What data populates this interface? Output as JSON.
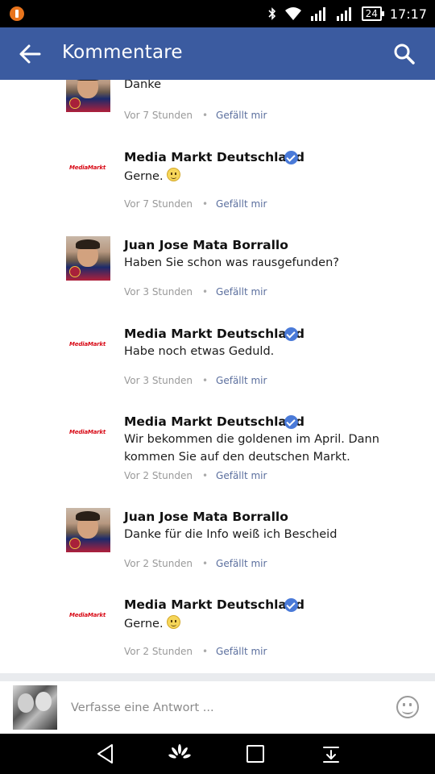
{
  "status": {
    "battery": "24",
    "time": "17:17"
  },
  "header": {
    "title": "Kommentare"
  },
  "comments": [
    {
      "author": "",
      "verified": false,
      "avatar": "person",
      "text": "Danke",
      "time": "Vor 7 Stunden",
      "like": "Gefällt mir",
      "emoji": false
    },
    {
      "author": "Media Markt Deutschland",
      "verified": true,
      "avatar": "mediamarkt",
      "text": "Gerne.",
      "time": "Vor 7 Stunden",
      "like": "Gefällt mir",
      "emoji": true
    },
    {
      "author": "Juan Jose Mata Borrallo",
      "verified": false,
      "avatar": "person",
      "text": "Haben Sie schon was rausgefunden?",
      "time": "Vor 3 Stunden",
      "like": "Gefällt mir",
      "emoji": false
    },
    {
      "author": "Media Markt Deutschland",
      "verified": true,
      "avatar": "mediamarkt",
      "text": "Habe noch etwas Geduld.",
      "time": "Vor 3 Stunden",
      "like": "Gefällt mir",
      "emoji": false
    },
    {
      "author": "Media Markt Deutschland",
      "verified": true,
      "avatar": "mediamarkt",
      "text": "Wir bekommen die goldenen im April. Dann kommen Sie auf den deutschen Markt.",
      "time": "Vor 2 Stunden",
      "like": "Gefällt mir",
      "emoji": false
    },
    {
      "author": "Juan Jose Mata Borrallo",
      "verified": false,
      "avatar": "person",
      "text": "Danke für die Info weiß ich Bescheid",
      "time": "Vor 2 Stunden",
      "like": "Gefällt mir",
      "emoji": false
    },
    {
      "author": "Media Markt Deutschland",
      "verified": true,
      "avatar": "mediamarkt",
      "text": "Gerne.",
      "time": "Vor 2 Stunden",
      "like": "Gefällt mir",
      "emoji": true
    }
  ],
  "logo_text": "MediaMarkt",
  "composer": {
    "placeholder": "Verfasse eine Antwort ..."
  },
  "colors": {
    "appbar": "#3b5ba0",
    "like_link": "#5b6f9e",
    "verified": "#4a7ad8",
    "brand_red": "#d80a16"
  }
}
